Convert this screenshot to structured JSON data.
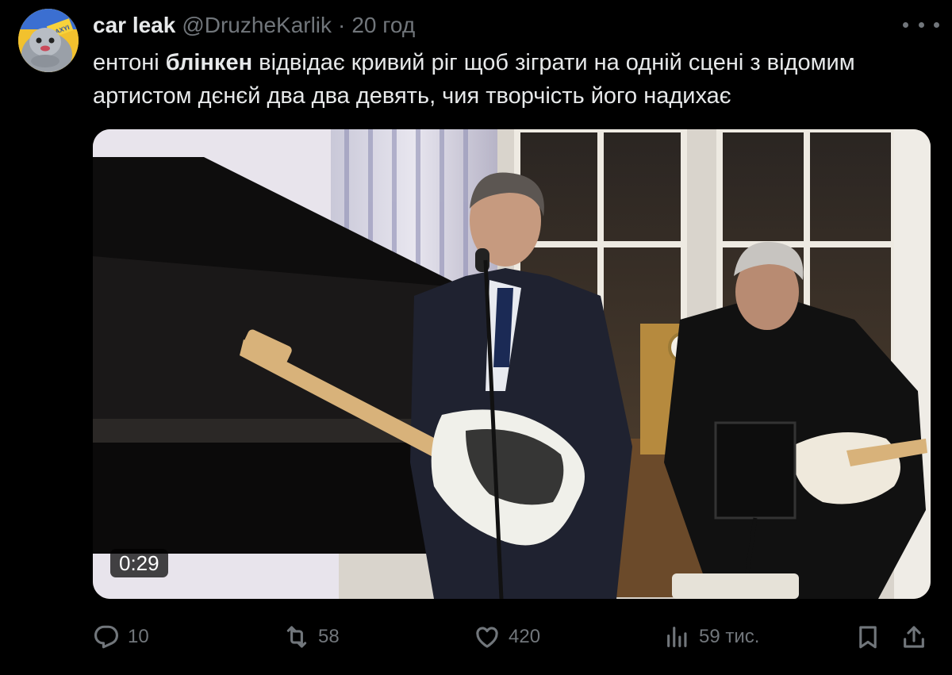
{
  "tweet": {
    "author_name": "car leak",
    "author_handle": "@DruzheKarlik",
    "separator": "·",
    "time": "20 год",
    "text_before": "ентоні ",
    "text_bold": "блінкен",
    "text_after": " відвідає кривий ріг щоб  зіграти на одній сцені з відомим артистом дєнєй два два девять, чия творчість його надихає",
    "video_duration": "0:29",
    "avatar_badge": "NAXYI"
  },
  "actions": {
    "replies": {
      "icon": "reply-icon",
      "count": "10"
    },
    "reposts": {
      "icon": "repost-icon",
      "count": "58"
    },
    "likes": {
      "icon": "heart-icon",
      "count": "420"
    },
    "views": {
      "icon": "views-icon",
      "count": "59 тис."
    },
    "bookmark": {
      "icon": "bookmark-icon"
    },
    "share": {
      "icon": "share-icon"
    }
  },
  "colors": {
    "background": "#000000",
    "text": "#e7e9ea",
    "muted": "#71767b"
  }
}
